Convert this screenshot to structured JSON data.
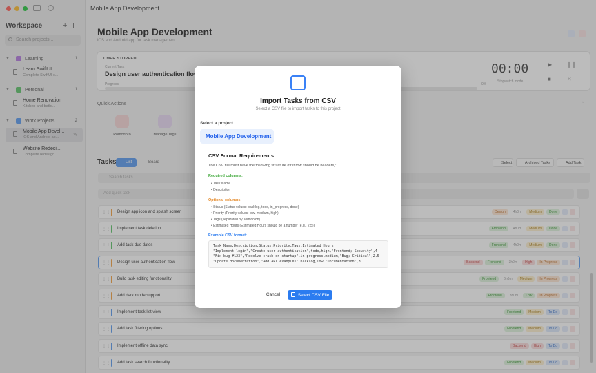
{
  "window": {
    "title": "Mobile App Development"
  },
  "sidebar": {
    "title": "Workspace",
    "add_label": "+",
    "search_placeholder": "Search projects...",
    "groups": [
      {
        "label": "Learning",
        "count": "1",
        "color": "#b47be0",
        "items": [
          {
            "title": "Learn SwiftUI",
            "subtitle": "Complete SwiftUI c..."
          }
        ]
      },
      {
        "label": "Personal",
        "count": "1",
        "color": "#5fc46b",
        "items": [
          {
            "title": "Home Renovation",
            "subtitle": "Kitchen and bathr..."
          }
        ]
      },
      {
        "label": "Work Projects",
        "count": "2",
        "color": "#5b9cf0",
        "items": [
          {
            "title": "Mobile App Devel...",
            "subtitle": "iOS and Android ap...",
            "selected": true
          },
          {
            "title": "Website Redesi...",
            "subtitle": "Complete redesign ..."
          }
        ]
      }
    ]
  },
  "header": {
    "title": "Mobile App Development",
    "subtitle": "iOS and Android app for task management"
  },
  "timer": {
    "status": "TIMER STOPPED",
    "current_label": "Current Task",
    "task": "Design user authentication flow",
    "progress_label": "Progress",
    "progress_pct": "0%",
    "progress_value": 0,
    "clock": "00:00",
    "mode": "Stopwatch mode"
  },
  "quick_actions": {
    "title": "Quick Actions",
    "items": [
      {
        "label": "Pomodoro",
        "color": "#f8d7d7"
      },
      {
        "label": "Manage Tags",
        "color": "#e9d9f5"
      }
    ]
  },
  "tasks": {
    "title": "Tasks",
    "view_list": "List",
    "view_board": "Board",
    "select_label": "Select",
    "archived_label": "Archived Tasks",
    "add_label": "Add Task",
    "search_placeholder": "Search tasks...",
    "quick_placeholder": "Add quick task",
    "rows": [
      {
        "name": "Design app icon and splash screen",
        "color": "#f5a142",
        "badges": [
          {
            "text": "Design",
            "bg": "#fde7d4",
            "fg": "#c0702b"
          },
          {
            "text": "4h0m",
            "bg": "transparent",
            "fg": "#999"
          },
          {
            "text": "Medium",
            "bg": "#fdf0cf",
            "fg": "#b08420"
          },
          {
            "text": "Done",
            "bg": "#dff3dd",
            "fg": "#3f9a3a"
          }
        ]
      },
      {
        "name": "Implement task deletion",
        "color": "#5fc46b",
        "badges": [
          {
            "text": "Frontend",
            "bg": "#dff3dd",
            "fg": "#3f9a3a"
          },
          {
            "text": "4h0m",
            "bg": "transparent",
            "fg": "#999"
          },
          {
            "text": "Medium",
            "bg": "#fdf0cf",
            "fg": "#b08420"
          },
          {
            "text": "Done",
            "bg": "#dff3dd",
            "fg": "#3f9a3a"
          }
        ]
      },
      {
        "name": "Add task due dates",
        "color": "#5fc46b",
        "badges": [
          {
            "text": "Frontend",
            "bg": "#dff3dd",
            "fg": "#3f9a3a"
          },
          {
            "text": "4h0m",
            "bg": "transparent",
            "fg": "#999"
          },
          {
            "text": "Medium",
            "bg": "#fdf0cf",
            "fg": "#b08420"
          },
          {
            "text": "Done",
            "bg": "#dff3dd",
            "fg": "#3f9a3a"
          }
        ]
      },
      {
        "name": "Design user authentication flow",
        "color": "#f5a142",
        "active": true,
        "badges": [
          {
            "text": "Backend",
            "bg": "#fbdcdc",
            "fg": "#c94a4a"
          },
          {
            "text": "Frontend",
            "bg": "#dff3dd",
            "fg": "#3f9a3a"
          },
          {
            "text": "3h0m",
            "bg": "transparent",
            "fg": "#999"
          },
          {
            "text": "High",
            "bg": "#fbdcdc",
            "fg": "#c94a4a"
          },
          {
            "text": "In Progress",
            "bg": "#fde7d4",
            "fg": "#c0702b"
          }
        ]
      },
      {
        "name": "Build task editing functionality",
        "color": "#f5a142",
        "badges": [
          {
            "text": "Frontend",
            "bg": "#dff3dd",
            "fg": "#3f9a3a"
          },
          {
            "text": "6h0m",
            "bg": "transparent",
            "fg": "#999"
          },
          {
            "text": "Medium",
            "bg": "#fdf0cf",
            "fg": "#b08420"
          },
          {
            "text": "In Progress",
            "bg": "#fde7d4",
            "fg": "#c0702b"
          }
        ]
      },
      {
        "name": "Add dark mode support",
        "color": "#f5a142",
        "badges": [
          {
            "text": "Frontend",
            "bg": "#dff3dd",
            "fg": "#3f9a3a"
          },
          {
            "text": "3h0m",
            "bg": "transparent",
            "fg": "#999"
          },
          {
            "text": "Low",
            "bg": "#dff3dd",
            "fg": "#3f9a3a"
          },
          {
            "text": "In Progress",
            "bg": "#fde7d4",
            "fg": "#c0702b"
          }
        ]
      },
      {
        "name": "Implement task list view",
        "color": "#5b9cf0",
        "badges": [
          {
            "text": "Frontend",
            "bg": "#dff3dd",
            "fg": "#3f9a3a"
          },
          {
            "text": "Medium",
            "bg": "#fdf0cf",
            "fg": "#b08420"
          },
          {
            "text": "To Do",
            "bg": "#dce8fb",
            "fg": "#3b72c9"
          }
        ]
      },
      {
        "name": "Add task filtering options",
        "color": "#5b9cf0",
        "badges": [
          {
            "text": "Frontend",
            "bg": "#dff3dd",
            "fg": "#3f9a3a"
          },
          {
            "text": "Medium",
            "bg": "#fdf0cf",
            "fg": "#b08420"
          },
          {
            "text": "To Do",
            "bg": "#dce8fb",
            "fg": "#3b72c9"
          }
        ]
      },
      {
        "name": "Implement offline data sync",
        "color": "#5b9cf0",
        "badges": [
          {
            "text": "Backend",
            "bg": "#fbdcdc",
            "fg": "#c94a4a"
          },
          {
            "text": "High",
            "bg": "#fbdcdc",
            "fg": "#c94a4a"
          },
          {
            "text": "To Do",
            "bg": "#dce8fb",
            "fg": "#3b72c9"
          }
        ]
      },
      {
        "name": "Add task search functionality",
        "color": "#5b9cf0",
        "badges": [
          {
            "text": "Frontend",
            "bg": "#dff3dd",
            "fg": "#3f9a3a"
          },
          {
            "text": "Medium",
            "bg": "#fdf0cf",
            "fg": "#b08420"
          },
          {
            "text": "To Do",
            "bg": "#dce8fb",
            "fg": "#3b72c9"
          }
        ]
      }
    ]
  },
  "modal": {
    "title": "Import Tasks from CSV",
    "subtitle": "Select a CSV file to import tasks to this project",
    "select_label": "Select a project",
    "project": "Mobile App Development",
    "req_title": "CSV Format Requirements",
    "req_desc": "The CSV file must have the following structure (first row should be headers):",
    "required_label": "Required columns:",
    "required": [
      "• Task Name",
      "• Description"
    ],
    "optional_label": "Optional columns:",
    "optional": [
      "• Status (Status values: backlog, todo, in_progress, done)",
      "• Priority (Priority values: low, medium, high)",
      "• Tags (separated by semicolon)",
      "• Estimated Hours (Estimated Hours should be a number (e.g., 2.5))"
    ],
    "example_label": "Example CSV format:",
    "example_code": "Task Name,Description,Status,Priority,Tags,Estimated Hours\n\"Implement login\",\"Create user authentication\",todo,high,\"Frontend; Security\",4\n\"Fix bug #123\",\"Resolve crash on startup\",in_progress,medium,\"Bug; Critical\",2.5\n\"Update documentation\",\"Add API examples\",backlog,low,\"Documentation\",3",
    "cancel_label": "Cancel",
    "confirm_label": "Select CSV File",
    "accent": "#2b7cf0",
    "required_color": "#3fa83a",
    "optional_color": "#e58a2a",
    "example_color": "#2b7cf0"
  }
}
